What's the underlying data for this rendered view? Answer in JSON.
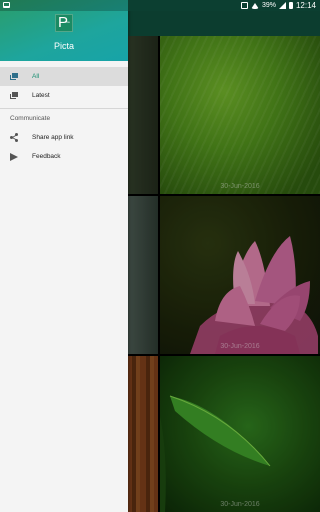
{
  "status_bar": {
    "battery": "39%",
    "time": "12:14"
  },
  "drawer": {
    "app_name": "Picta",
    "logo_letter": "P",
    "logo_sub": "icta",
    "items": [
      {
        "label": "All",
        "icon": "photo-stack-icon",
        "selected": true
      },
      {
        "label": "Latest",
        "icon": "photo-stack-icon",
        "selected": false
      }
    ],
    "section_title": "Communicate",
    "communicate_items": [
      {
        "label": "Share app link",
        "icon": "share-icon"
      },
      {
        "label": "Feedback",
        "icon": "send-icon"
      }
    ]
  },
  "grid": {
    "dates": [
      "30-Jun-2016",
      "30-Jun-2016",
      "30-Jun-2016"
    ]
  },
  "colors": {
    "accent": "#1a8f72",
    "header_start": "#2a9d6a",
    "header_end": "#17a3a8",
    "app_bar": "#0f4b3a"
  }
}
